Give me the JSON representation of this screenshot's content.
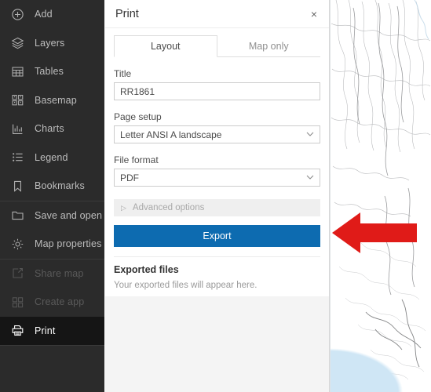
{
  "sidebar": {
    "items": [
      {
        "label": "Add",
        "icon": "plus-circle-icon",
        "state": "enabled",
        "badge": false
      },
      {
        "label": "Layers",
        "icon": "layers-icon",
        "state": "enabled",
        "badge": false
      },
      {
        "label": "Tables",
        "icon": "table-icon",
        "state": "enabled",
        "badge": false
      },
      {
        "label": "Basemap",
        "icon": "basemap-grid-icon",
        "state": "enabled",
        "badge": false
      },
      {
        "label": "Charts",
        "icon": "bar-chart-icon",
        "state": "enabled",
        "badge": false
      },
      {
        "label": "Legend",
        "icon": "legend-list-icon",
        "state": "enabled",
        "badge": false
      },
      {
        "label": "Bookmarks",
        "icon": "bookmark-icon",
        "state": "enabled",
        "badge": false
      },
      {
        "label": "Save and open",
        "icon": "folder-icon",
        "state": "enabled",
        "badge": true
      },
      {
        "label": "Map properties",
        "icon": "gear-icon",
        "state": "enabled",
        "badge": false
      },
      {
        "label": "Share map",
        "icon": "share-icon",
        "state": "disabled",
        "badge": false
      },
      {
        "label": "Create app",
        "icon": "apps-grid-icon",
        "state": "disabled",
        "badge": false
      },
      {
        "label": "Print",
        "icon": "printer-icon",
        "state": "active",
        "badge": false
      }
    ]
  },
  "panel": {
    "title": "Print",
    "close_label": "×",
    "tabs": [
      {
        "label": "Layout",
        "active": true
      },
      {
        "label": "Map only",
        "active": false
      }
    ],
    "title_field": {
      "label": "Title",
      "value": "RR1861"
    },
    "page_setup": {
      "label": "Page setup",
      "value": "Letter ANSI A landscape"
    },
    "file_format": {
      "label": "File format",
      "value": "PDF"
    },
    "advanced_options": {
      "label": "Advanced options",
      "marker": "▷"
    },
    "export_button": "Export",
    "exported_files": {
      "heading": "Exported files",
      "empty_message": "Your exported files will appear here."
    }
  },
  "annotation": {
    "arrow": "left-pointing-red-arrow",
    "color": "#e01b18"
  },
  "colors": {
    "sidebar_bg": "#2b2b2b",
    "sidebar_active_bg": "#151515",
    "accent_blue": "#0d6bb0",
    "badge_blue": "#1f8fd6",
    "panel_bg": "#f4f4f4",
    "water": "#cfe6f5"
  }
}
